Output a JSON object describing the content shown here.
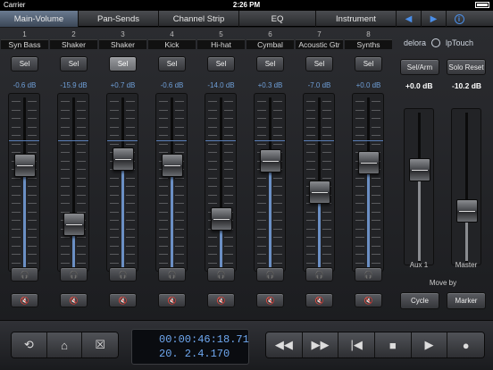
{
  "status": {
    "carrier": "Carrier",
    "time": "2:26 PM"
  },
  "tabs": [
    {
      "label": "Main-Volume",
      "active": true
    },
    {
      "label": "Pan-Sends"
    },
    {
      "label": "Channel Strip"
    },
    {
      "label": "EQ"
    },
    {
      "label": "Instrument"
    }
  ],
  "nav": {
    "prev": "◀",
    "next": "▶",
    "info": "i"
  },
  "channels": [
    {
      "num": "1",
      "name": "Syn Bass",
      "sel": "Sel",
      "db": "-0.6 dB",
      "level": 0.62,
      "selected": false
    },
    {
      "num": "2",
      "name": "Shaker",
      "sel": "Sel",
      "db": "-15.9 dB",
      "level": 0.22,
      "selected": false
    },
    {
      "num": "3",
      "name": "Shaker",
      "sel": "Sel",
      "db": "+0.7 dB",
      "level": 0.66,
      "selected": true
    },
    {
      "num": "4",
      "name": "Kick",
      "sel": "Sel",
      "db": "-0.6 dB",
      "level": 0.62,
      "selected": false
    },
    {
      "num": "5",
      "name": "Hi-hat",
      "sel": "Sel",
      "db": "-14.0 dB",
      "level": 0.26,
      "selected": false
    },
    {
      "num": "6",
      "name": "Cymbal",
      "sel": "Sel",
      "db": "+0.3 dB",
      "level": 0.65,
      "selected": false
    },
    {
      "num": "7",
      "name": "Acoustic Gtr",
      "sel": "Sel",
      "db": "-7.0 dB",
      "level": 0.44,
      "selected": false
    },
    {
      "num": "8",
      "name": "Synths",
      "sel": "Sel",
      "db": "+0.0 dB",
      "level": 0.64,
      "selected": false
    }
  ],
  "brand": {
    "left": "delora",
    "right": "lpTouch"
  },
  "right": {
    "selarm": "Sel/Arm",
    "soloreset": "Solo Reset",
    "aux_db": "+0.0 dB",
    "master_db": "-10.2 dB",
    "aux_label": "Aux 1",
    "master_label": "Master",
    "aux_level": 0.64,
    "master_level": 0.32,
    "moveby": "Move by",
    "cycle": "Cycle",
    "marker": "Marker"
  },
  "transport": {
    "time": "00:00:46:18.71",
    "bars": "20. 2.4.170"
  }
}
